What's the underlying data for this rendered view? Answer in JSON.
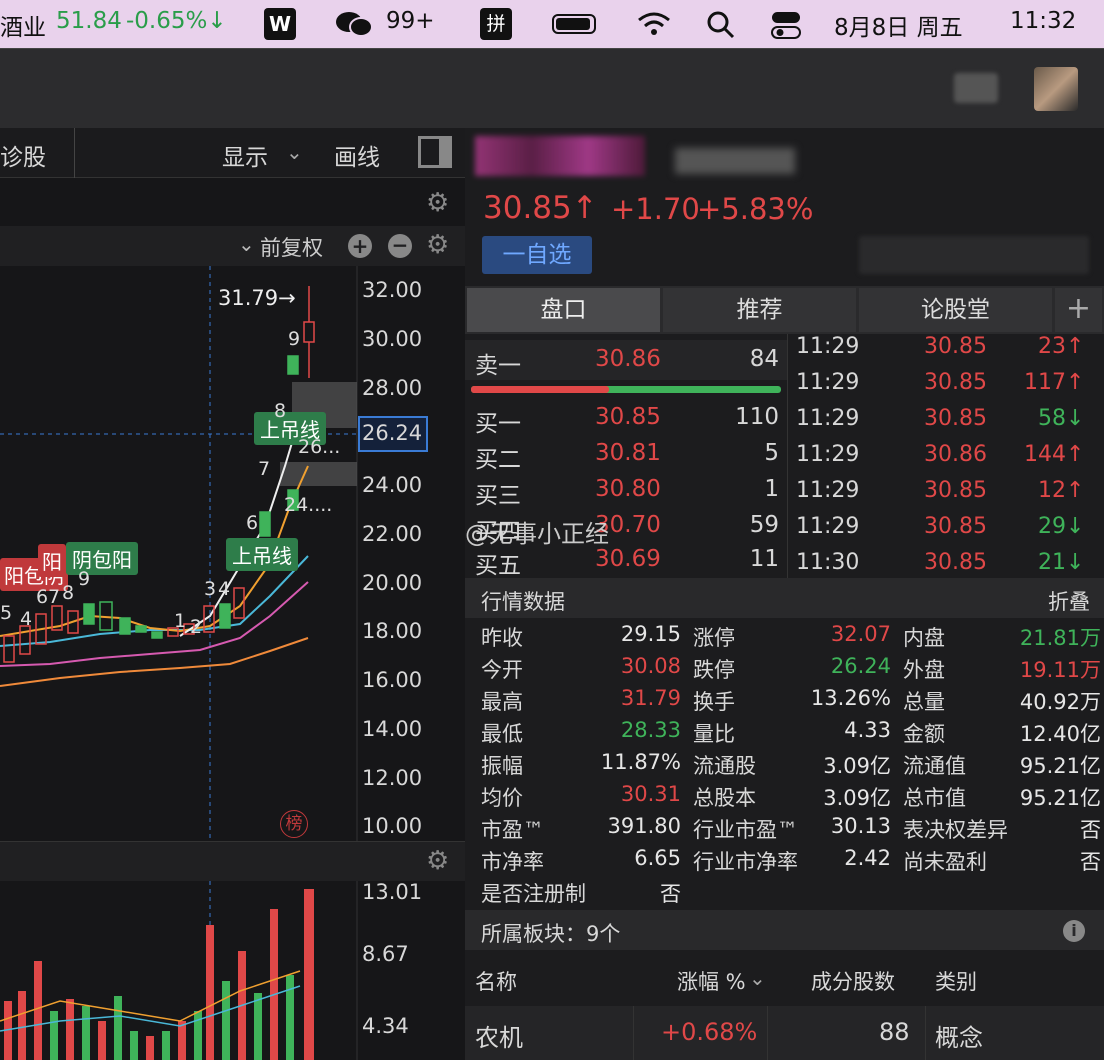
{
  "menubar": {
    "stock": "酒业",
    "stock_price": "51.84",
    "stock_change": "-0.65%↓",
    "wechat_count": "99+",
    "date": "8月8日 周五",
    "time": "11:32",
    "pin": "拼"
  },
  "left": {
    "toolbar": {
      "diagnose": "诊股",
      "display": "显示",
      "draw": "画线",
      "fq": "前复权"
    },
    "price_axis": [
      "32.00",
      "30.00",
      "28.00",
      "26.24",
      "24.00",
      "22.00",
      "20.00",
      "18.00",
      "16.00",
      "14.00",
      "12.00",
      "10.00"
    ],
    "high_label": "31.79→",
    "labels": {
      "hang1": "上吊线",
      "hang2": "上吊线",
      "pat1": "阳包阴",
      "pat2": "阴包阳",
      "pat3": "阳",
      "val1": "26...",
      "val2": "24...."
    },
    "nums": [
      "9",
      "8",
      "7",
      "6",
      "3",
      "4",
      "1",
      "2",
      "3",
      "4",
      "5",
      "6",
      "7",
      "8",
      "9"
    ],
    "bang": "榜",
    "vol_axis": [
      "13.01",
      "8.67",
      "4.34"
    ]
  },
  "stock": {
    "price": "30.85↑",
    "change": "+1.70",
    "pct": "+5.83%",
    "watch_btn": "一自选"
  },
  "tabs": [
    "盘口",
    "推荐",
    "论股堂"
  ],
  "orderbook": {
    "sell": [
      {
        "label": "卖一",
        "price": "30.86",
        "vol": "84"
      }
    ],
    "buy": [
      {
        "label": "买一",
        "price": "30.85",
        "vol": "110"
      },
      {
        "label": "买二",
        "price": "30.81",
        "vol": "5"
      },
      {
        "label": "买三",
        "price": "30.80",
        "vol": "1"
      },
      {
        "label": "买四",
        "price": "30.70",
        "vol": "59"
      },
      {
        "label": "买五",
        "price": "30.69",
        "vol": "11"
      }
    ]
  },
  "ticks": [
    {
      "t": "11:29",
      "p": "30.85",
      "v": "23↑",
      "c": "red"
    },
    {
      "t": "11:29",
      "p": "30.85",
      "v": "117↑",
      "c": "red"
    },
    {
      "t": "11:29",
      "p": "30.85",
      "v": "58↓",
      "c": "green"
    },
    {
      "t": "11:29",
      "p": "30.86",
      "v": "144↑",
      "c": "red"
    },
    {
      "t": "11:29",
      "p": "30.85",
      "v": "12↑",
      "c": "red"
    },
    {
      "t": "11:29",
      "p": "30.85",
      "v": "29↓",
      "c": "green"
    },
    {
      "t": "11:30",
      "p": "30.85",
      "v": "21↓",
      "c": "green"
    }
  ],
  "market": {
    "title": "行情数据",
    "collapse": "折叠",
    "rows": [
      [
        [
          "昨收",
          "29.15",
          "wht"
        ],
        [
          "涨停",
          "32.07",
          "red"
        ],
        [
          "内盘",
          "21.81万",
          "green"
        ]
      ],
      [
        [
          "今开",
          "30.08",
          "red"
        ],
        [
          "跌停",
          "26.24",
          "green"
        ],
        [
          "外盘",
          "19.11万",
          "red"
        ]
      ],
      [
        [
          "最高",
          "31.79",
          "red"
        ],
        [
          "换手",
          "13.26%",
          "wht"
        ],
        [
          "总量",
          "40.92万",
          "wht"
        ]
      ],
      [
        [
          "最低",
          "28.33",
          "green"
        ],
        [
          "量比",
          "4.33",
          "wht"
        ],
        [
          "金额",
          "12.40亿",
          "wht"
        ]
      ],
      [
        [
          "振幅",
          "11.87%",
          "wht"
        ],
        [
          "流通股",
          "3.09亿",
          "wht"
        ],
        [
          "流通值",
          "95.21亿",
          "wht"
        ]
      ],
      [
        [
          "均价",
          "30.31",
          "red"
        ],
        [
          "总股本",
          "3.09亿",
          "wht"
        ],
        [
          "总市值",
          "95.21亿",
          "wht"
        ]
      ],
      [
        [
          "市盈™",
          "391.80",
          "wht"
        ],
        [
          "行业市盈™",
          "30.13",
          "wht"
        ],
        [
          "表决权差异",
          "否",
          "wht"
        ]
      ],
      [
        [
          "市净率",
          "6.65",
          "wht"
        ],
        [
          "行业市净率",
          "2.42",
          "wht"
        ],
        [
          "尚未盈利",
          "否",
          "wht"
        ]
      ],
      [
        [
          "是否注册制",
          "否",
          "wht"
        ],
        [
          "",
          "",
          ""
        ],
        [
          "",
          "",
          ""
        ]
      ]
    ]
  },
  "sector": {
    "title": "所属板块：9个",
    "cols": [
      "名称",
      "涨幅 %",
      "成分股数",
      "类别"
    ],
    "row": {
      "name": "农机",
      "pct": "+0.68%",
      "count": "88",
      "type": "概念"
    }
  },
  "watermark": "@无事小正经"
}
